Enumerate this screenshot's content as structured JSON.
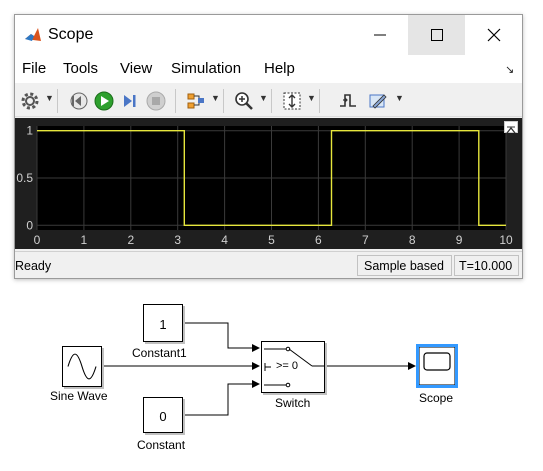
{
  "window": {
    "title": "Scope",
    "menus": [
      "File",
      "Tools",
      "View",
      "Simulation",
      "Help"
    ]
  },
  "plot": {
    "x_ticks": [
      "0",
      "1",
      "2",
      "3",
      "4",
      "5",
      "6",
      "7",
      "8",
      "9",
      "10"
    ],
    "y_ticks": [
      "1",
      "0.5",
      "0"
    ],
    "colors": {
      "background": "#000000",
      "grid": "#3a3a3a",
      "signal": "#e6e63c",
      "tick_text": "#d0d0d0"
    }
  },
  "chart_data": {
    "type": "line",
    "x": [
      0,
      3.14,
      3.14,
      6.28,
      6.28,
      9.42,
      9.42,
      10
    ],
    "series": [
      {
        "values": [
          1,
          1,
          0,
          0,
          1,
          1,
          0,
          0
        ]
      }
    ],
    "xlim": [
      0,
      10
    ],
    "ylim": [
      -0.05,
      1.05
    ],
    "grid": true
  },
  "status": {
    "text": "Ready",
    "mode": "Sample based",
    "time": "T=10.000"
  },
  "diagram": {
    "constant1": {
      "value": "1",
      "label": "Constant1"
    },
    "constant": {
      "value": "0",
      "label": "Constant"
    },
    "sine": {
      "label": "Sine Wave"
    },
    "switch": {
      "criteria": ">= 0",
      "label": "Switch"
    },
    "scope": {
      "label": "Scope"
    },
    "colors": {
      "scope_highlight": "#3399ff"
    }
  }
}
